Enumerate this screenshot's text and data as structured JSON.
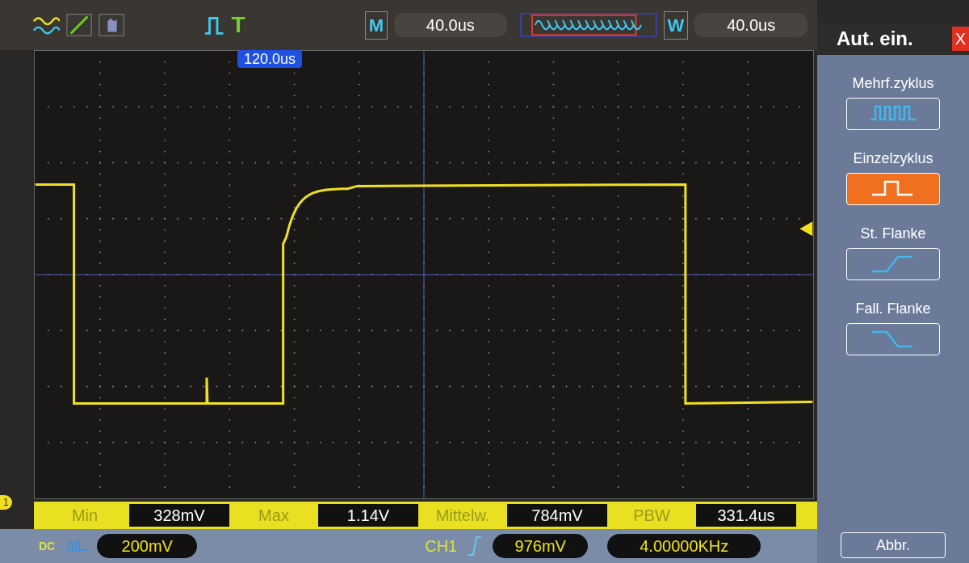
{
  "top_bar": {
    "trigger_label": "T",
    "time_base_label": "M",
    "time_base": "40.0us",
    "window_label": "W",
    "window_time": "40.0us",
    "trigger_position": "120.0us"
  },
  "plot": {
    "channel_marker": "1"
  },
  "menu": {
    "title": "Aut. ein.",
    "close": "X",
    "cancel": "Abbr.",
    "items": [
      {
        "label": "Mehrf.zyklus",
        "kind": "multi",
        "selected": false
      },
      {
        "label": "Einzelzyklus",
        "kind": "single",
        "selected": true
      },
      {
        "label": "St. Flanke",
        "kind": "rise",
        "selected": false
      },
      {
        "label": "Fall. Flanke",
        "kind": "fall",
        "selected": false
      }
    ]
  },
  "measurements": [
    {
      "label": "Min",
      "value": "328mV"
    },
    {
      "label": "Max",
      "value": "1.14V"
    },
    {
      "label": "Mittelw.",
      "value": "784mV"
    },
    {
      "label": "PBW",
      "value": "331.4us"
    }
  ],
  "status": {
    "coupling": "DC",
    "volts_div": "200mV",
    "trigger_channel": "CH1",
    "trigger_level": "976mV",
    "frequency": "4.00000KHz"
  }
}
